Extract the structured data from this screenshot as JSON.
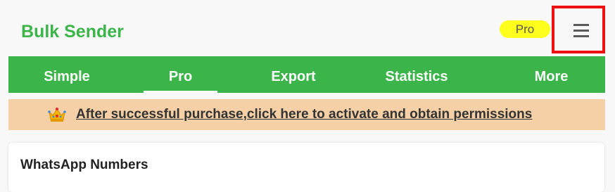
{
  "app": {
    "title": "Bulk Sender",
    "plan_badge": "Pro"
  },
  "header": {
    "menu_icon": "hamburger-menu-icon",
    "highlight_color": "#ee1111"
  },
  "tabs": [
    {
      "label": "Simple",
      "active": false
    },
    {
      "label": "Pro",
      "active": true
    },
    {
      "label": "Export",
      "active": false
    },
    {
      "label": "Statistics",
      "active": false
    },
    {
      "label": "More",
      "active": false
    }
  ],
  "banner": {
    "icon": "crown-icon",
    "text": "After successful purchase,click here to activate and obtain permissions"
  },
  "card": {
    "title": "WhatsApp Numbers"
  },
  "colors": {
    "brand_green": "#3bb54a",
    "badge_yellow": "#ffff1e",
    "banner_bg": "#f5d0a6"
  }
}
